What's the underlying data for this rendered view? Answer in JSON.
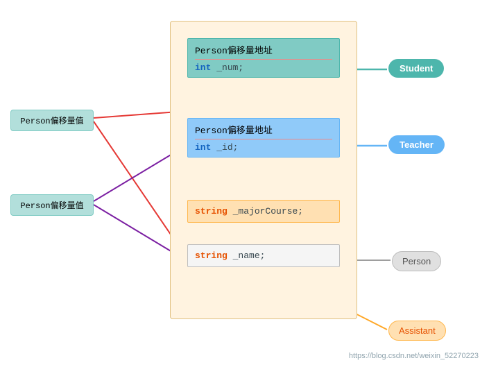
{
  "main": {
    "offsetBox1": {
      "title": "Person偏移量地址",
      "code": "int _num;"
    },
    "offsetBox2": {
      "title": "Person偏移量地址",
      "code": "int _id;"
    },
    "majorBox": {
      "code_kw": "string",
      "code_var": " _majorCourse;"
    },
    "nameBox": {
      "code_kw": "string",
      "code_var": " _name;"
    },
    "valueBox1": "Person偏移量值",
    "valueBox2": "Person偏移量值",
    "studentLabel": "Student",
    "teacherLabel": "Teacher",
    "personLabel": "Person",
    "assistantLabel": "Assistant",
    "watermark": "https://blog.csdn.net/weixin_52270223"
  }
}
